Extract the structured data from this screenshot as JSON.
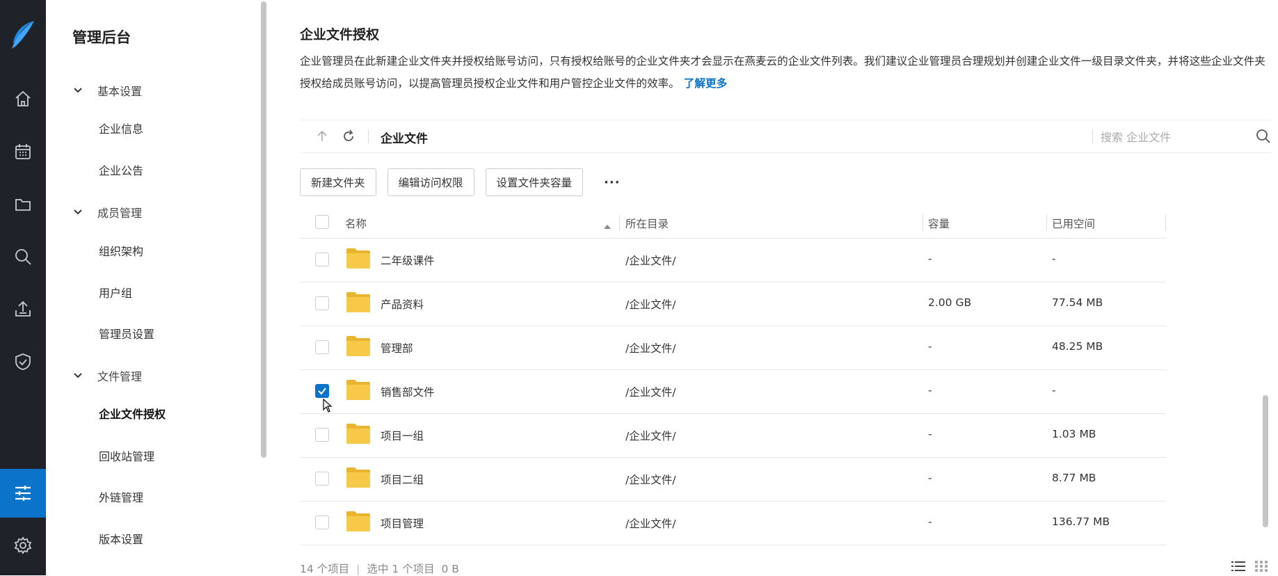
{
  "brand": {
    "title": "管理后台"
  },
  "rail": {
    "icons": [
      "logo-icon",
      "home-icon",
      "calendar-icon",
      "folder-icon",
      "search-icon",
      "upload-icon",
      "shield-icon",
      "settings-sliders-icon",
      "gear-icon"
    ],
    "active": "settings-sliders-icon",
    "accent": "#0b73c9",
    "background": "#1f2329"
  },
  "nav": {
    "groups": [
      {
        "label": "基本设置",
        "items": [
          "企业信息",
          "企业公告"
        ]
      },
      {
        "label": "成员管理",
        "items": [
          "组织架构",
          "用户组",
          "管理员设置"
        ]
      },
      {
        "label": "文件管理",
        "items": [
          "企业文件授权",
          "回收站管理",
          "外链管理",
          "版本设置"
        ]
      }
    ],
    "active_item": "企业文件授权"
  },
  "page": {
    "title": "企业文件授权",
    "description": "企业管理员在此新建企业文件夹并授权给账号访问，只有授权给账号的企业文件夹才会显示在燕麦云的企业文件列表。我们建议企业管理员合理规划并创建企业文件一级目录文件夹，并将这些企业文件夹授权给成员账号访问，以提高管理员授权企业文件和用户管控企业文件的效率。",
    "learn_more": "了解更多"
  },
  "pathbar": {
    "crumb": "企业文件",
    "search_placeholder": "搜索 企业文件"
  },
  "toolbar": {
    "new_folder": "新建文件夹",
    "edit_access": "编辑访问权限",
    "set_capacity": "设置文件夹容量",
    "more": "···"
  },
  "table": {
    "headers": {
      "name": "名称",
      "dir": "所在目录",
      "capacity": "容量",
      "used": "已用空间"
    },
    "sort": "name-asc",
    "rows": [
      {
        "name": "二年级课件",
        "dir": "/企业文件/",
        "capacity": "-",
        "used": "-",
        "checked": false
      },
      {
        "name": "产品资料",
        "dir": "/企业文件/",
        "capacity": "2.00 GB",
        "used": "77.54 MB",
        "checked": false
      },
      {
        "name": "管理部",
        "dir": "/企业文件/",
        "capacity": "-",
        "used": "48.25 MB",
        "checked": false
      },
      {
        "name": "销售部文件",
        "dir": "/企业文件/",
        "capacity": "-",
        "used": "-",
        "checked": true
      },
      {
        "name": "项目一组",
        "dir": "/企业文件/",
        "capacity": "-",
        "used": "1.03 MB",
        "checked": false
      },
      {
        "name": "项目二组",
        "dir": "/企业文件/",
        "capacity": "-",
        "used": "8.77 MB",
        "checked": false
      },
      {
        "name": "项目管理",
        "dir": "/企业文件/",
        "capacity": "-",
        "used": "136.77 MB",
        "checked": false
      }
    ]
  },
  "status": {
    "total": "14 个项目",
    "selected": "选中 1 个项目",
    "size": "0 B"
  },
  "colors": {
    "folder": "#f7c948",
    "folder_tab": "#e9b52e",
    "checkbox_checked": "#0b73c9"
  }
}
